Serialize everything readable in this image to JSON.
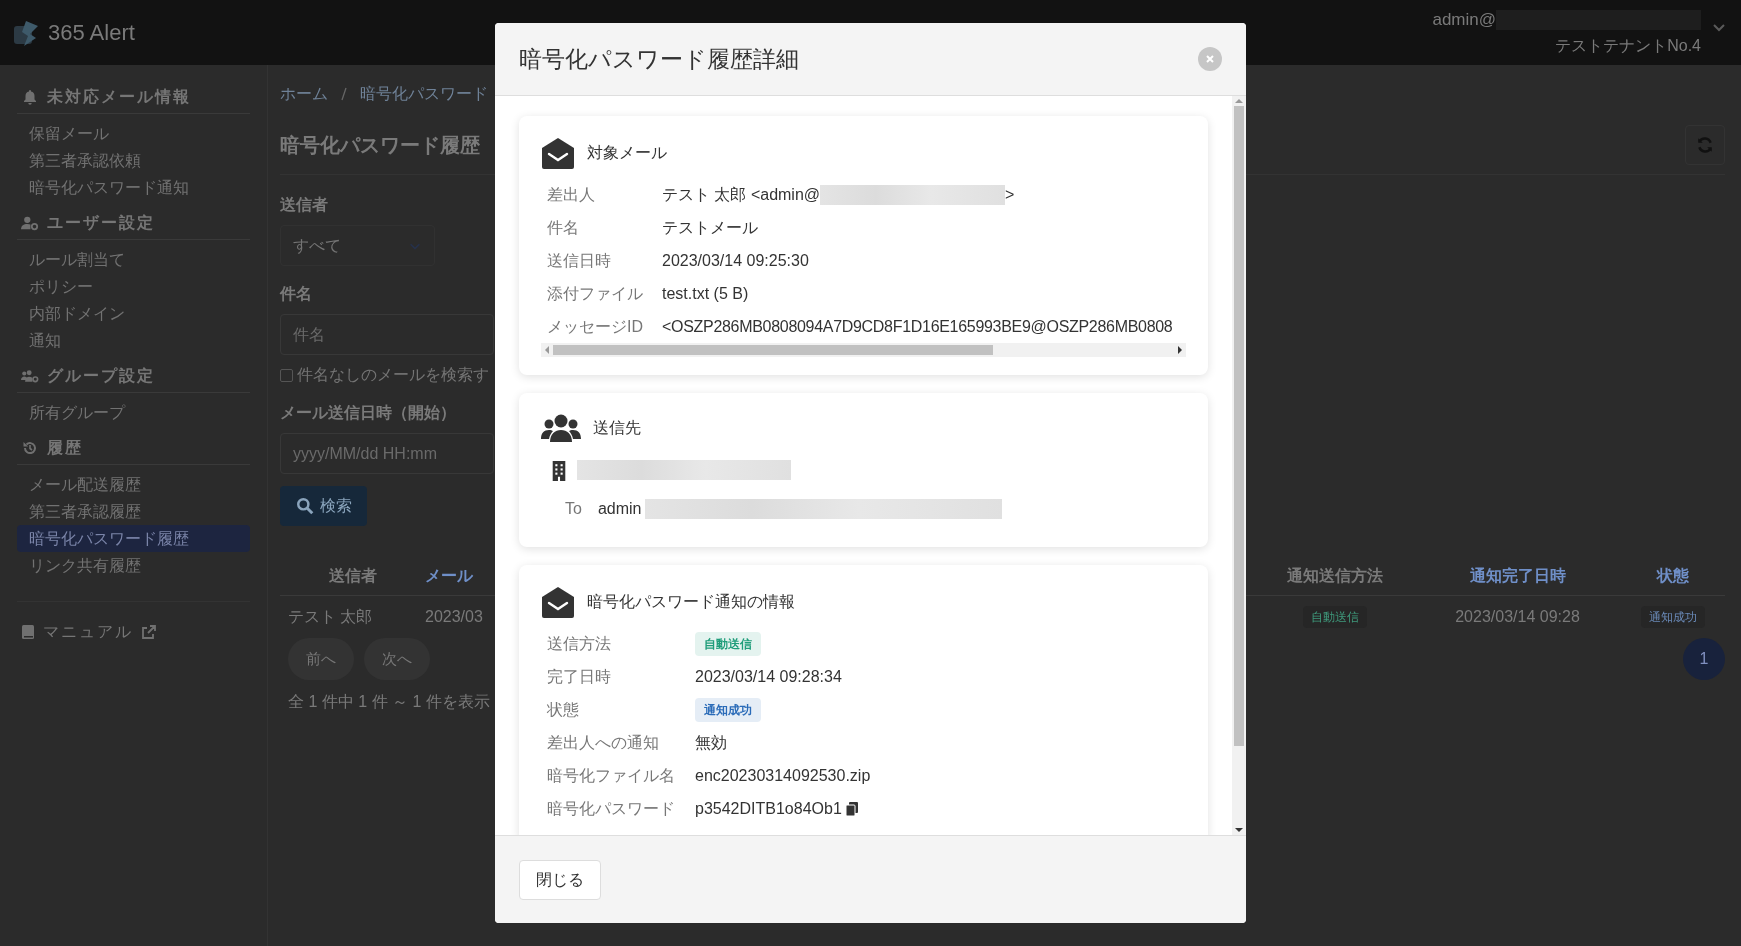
{
  "header": {
    "app_name": "365 Alert",
    "user": "admin@",
    "user_redacted": true,
    "tenant": "テストテナントNo.4"
  },
  "sidebar": {
    "sections": [
      {
        "title": "未対応メール情報",
        "items": [
          {
            "label": "保留メール",
            "selected": false
          },
          {
            "label": "第三者承認依頼",
            "selected": false
          },
          {
            "label": "暗号化パスワード通知",
            "selected": false
          }
        ]
      },
      {
        "title": "ユーザー設定",
        "items": [
          {
            "label": "ルール割当て",
            "selected": false
          },
          {
            "label": "ポリシー",
            "selected": false
          },
          {
            "label": "内部ドメイン",
            "selected": false
          },
          {
            "label": "通知",
            "selected": false
          }
        ]
      },
      {
        "title": "グループ設定",
        "items": [
          {
            "label": "所有グループ",
            "selected": false
          }
        ]
      },
      {
        "title": "履歴",
        "items": [
          {
            "label": "メール配送履歴",
            "selected": false
          },
          {
            "label": "第三者承認履歴",
            "selected": false
          },
          {
            "label": "暗号化パスワード履歴",
            "selected": true
          },
          {
            "label": "リンク共有履歴",
            "selected": false
          }
        ]
      }
    ],
    "manual_link": "マニュアル"
  },
  "breadcrumb": [
    "ホーム",
    "暗号化パスワード"
  ],
  "page_title": "暗号化パスワード履歴",
  "filters": {
    "sender_label": "送信者",
    "sender_value": "すべて",
    "subject_label": "件名",
    "subject_placeholder": "件名",
    "no_subject": {
      "label": "件名なしのメールを検索す",
      "checked": false
    },
    "date_label": "メール送信日時（開始）",
    "date_placeholder": "yyyy/MM/dd HH:mm",
    "search_button": "検索"
  },
  "table": {
    "columns": [
      {
        "label": "送信者",
        "sortable": false
      },
      {
        "label": "メール",
        "sortable": true
      },
      {
        "label": "通知送信方法",
        "sortable": false
      },
      {
        "label": "通知完了日時",
        "sortable": true
      },
      {
        "label": "状態",
        "sortable": true
      }
    ],
    "rows": [
      {
        "cells": [
          {
            "kind": "text",
            "text": "テスト 太郎"
          },
          {
            "kind": "text",
            "text": "2023/03"
          },
          {
            "kind": "badge",
            "text": "自動送信",
            "color": "#3f9a7c"
          },
          {
            "kind": "text",
            "text": "2023/03/14 09:28"
          },
          {
            "kind": "badge",
            "text": "通知成功",
            "color": "#6a8ab8"
          }
        ]
      }
    ]
  },
  "pagination": {
    "prev": "前へ",
    "next": "次へ",
    "pages": [
      {
        "label": "1",
        "selected": true
      }
    ],
    "summary": "全 1 件中 1 件 ～ 1 件を表示"
  },
  "modal": {
    "title": "暗号化パスワード履歴詳細",
    "sections": [
      {
        "kind": "fields",
        "title": "対象メール",
        "fields": [
          {
            "kind": "text",
            "label": "差出人",
            "value": "テスト 太郎 <admin@",
            "redacted": true,
            "suffix": ">"
          },
          {
            "kind": "text",
            "label": "件名",
            "value": "テストメール",
            "redacted": false
          },
          {
            "kind": "text",
            "label": "送信日時",
            "value": "2023/03/14 09:25:30",
            "redacted": false
          },
          {
            "kind": "text",
            "label": "添付ファイル",
            "value": "test.txt (5 B)",
            "redacted": false
          },
          {
            "kind": "text",
            "label": "メッセージID",
            "value": "<OSZP286MB0808094A7D9CD8F1D16E165993BE9@OSZP286MB0808",
            "redacted": false
          }
        ],
        "scrollbar": true
      },
      {
        "kind": "recipients",
        "title": "送信先",
        "organization_redacted": true,
        "recipients": [
          {
            "type": "To",
            "address": "admin",
            "redacted": true
          }
        ]
      },
      {
        "kind": "fields",
        "title": "暗号化パスワード通知の情報",
        "fields": [
          {
            "kind": "badge",
            "label": "送信方法",
            "value": "自動送信",
            "color": "#1f9d7a",
            "redacted": false
          },
          {
            "kind": "text",
            "label": "完了日時",
            "value": "2023/03/14 09:28:34",
            "redacted": false
          },
          {
            "kind": "badge",
            "label": "状態",
            "value": "通知成功",
            "color": "#2a6bb8",
            "redacted": false
          },
          {
            "kind": "text",
            "label": "差出人への通知",
            "value": "無効",
            "redacted": false
          },
          {
            "kind": "text",
            "label": "暗号化ファイル名",
            "value": "enc20230314092530.zip",
            "redacted": false
          },
          {
            "kind": "text",
            "label": "暗号化パスワード",
            "value": "p3542DITB1o84Ob1",
            "copyable": true,
            "redacted": false
          }
        ]
      }
    ],
    "close_button": "閉じる"
  }
}
